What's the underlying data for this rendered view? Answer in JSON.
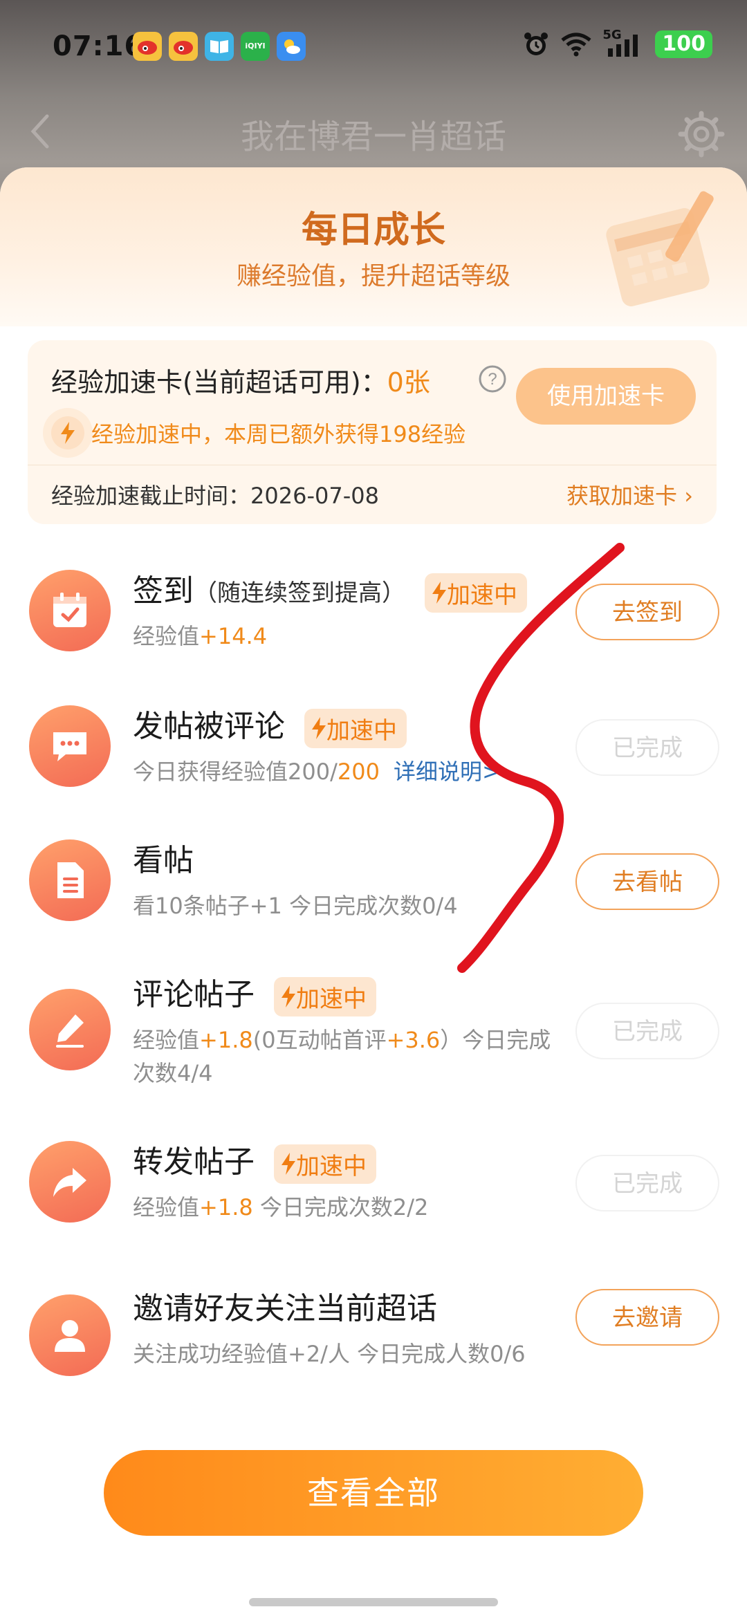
{
  "status_bar": {
    "time": "07:16",
    "notification_icons": [
      "weibo-icon",
      "weibo-icon",
      "book-icon",
      "iqiyi-icon",
      "weather-icon"
    ],
    "iqiyi_text": "iQIYI",
    "network": "5G",
    "battery": "100"
  },
  "nav": {
    "title": "我在博君一肖超话"
  },
  "sheet": {
    "title": "每日成长",
    "subtitle": "赚经验值，提升超话等级"
  },
  "speed_card": {
    "title_prefix": "经验加速卡(当前超话可用)：",
    "count": "0张",
    "use_button": "使用加速卡",
    "boost_status": "经验加速中，本周已额外获得198经验",
    "deadline": "经验加速截止时间：2026-07-08",
    "get_link": "获取加速卡 ›"
  },
  "boost_label": "加速中",
  "tasks": [
    {
      "title": "签到",
      "hint": "（随连续签到提高）",
      "boosted": true,
      "desc_prefix": "经验值",
      "desc_plus": "+14.4",
      "button": "去签到",
      "status": "go",
      "icon": "calendar-check-icon"
    },
    {
      "title": "发帖被评论",
      "boosted": true,
      "desc_prefix": "今日获得经验值200/",
      "desc_plus": "200",
      "link": "详细说明>",
      "button": "已完成",
      "status": "done",
      "icon": "chat-bubble-icon"
    },
    {
      "title": "看帖",
      "boosted": false,
      "desc_prefix": "看10条帖子+1   今日完成次数0/4",
      "button": "去看帖",
      "status": "go",
      "icon": "document-icon"
    },
    {
      "title": "评论帖子",
      "boosted": true,
      "desc_prefix": "经验值",
      "desc_plus": "+1.8",
      "desc_mid": "(0互动帖首评",
      "desc_plus2": "+3.6",
      "desc_suffix": "）今日完成次数4/4",
      "button": "已完成",
      "status": "done",
      "icon": "pencil-icon"
    },
    {
      "title": "转发帖子",
      "boosted": true,
      "desc_prefix": "经验值",
      "desc_plus": "+1.8",
      "desc_suffix": "  今日完成次数2/2",
      "button": "已完成",
      "status": "done",
      "icon": "share-arrow-icon"
    },
    {
      "title": "邀请好友关注当前超话",
      "boosted": false,
      "desc_prefix": "关注成功经验值+2/人   今日完成人数0/6",
      "button": "去邀请",
      "status": "go",
      "icon": "user-icon"
    }
  ],
  "view_all": "查看全部",
  "colors": {
    "accent": "#f08a1a",
    "title_orange": "#d06a1e",
    "link_blue": "#2f6fb6",
    "done_gray": "#d4d4d4",
    "scribble_red": "#e0141e"
  }
}
